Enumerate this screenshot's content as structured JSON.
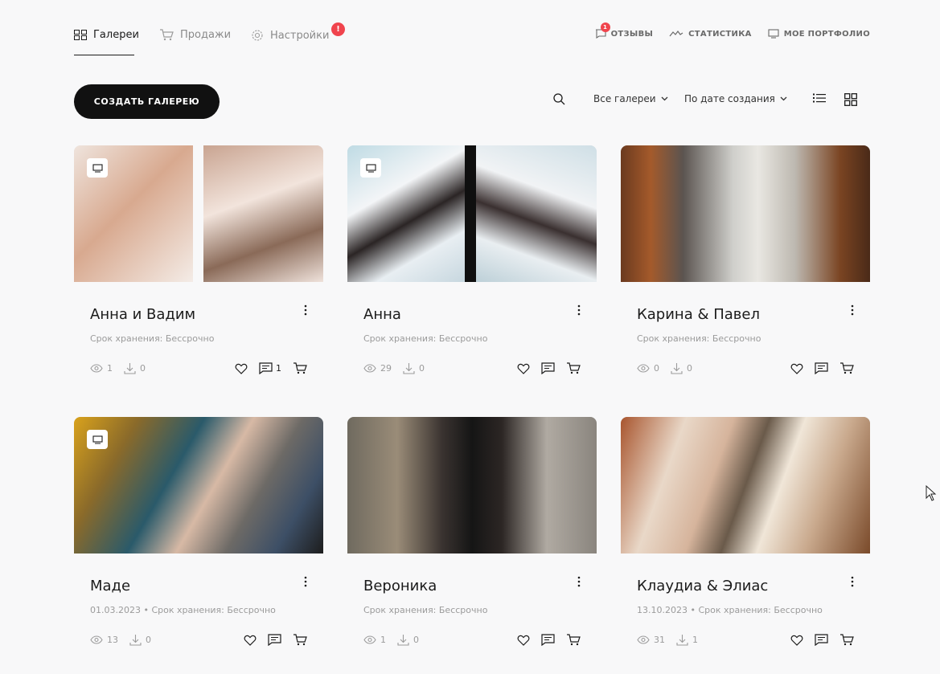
{
  "nav": {
    "tabs": [
      {
        "label": "Галереи"
      },
      {
        "label": "Продажи"
      },
      {
        "label": "Настройки"
      }
    ],
    "alert_badge": "!",
    "right_links": [
      {
        "label": "ОТЗЫВЫ",
        "badge": "1"
      },
      {
        "label": "СТАТИСТИКА"
      },
      {
        "label": "МОЕ ПОРТФОЛИО"
      }
    ]
  },
  "toolbar": {
    "create_label": "СОЗДАТЬ ГАЛЕРЕЮ",
    "filter_label": "Все галереи",
    "sort_label": "По дате создания"
  },
  "colors": {
    "accent": "#111111",
    "badge": "#f0444d",
    "muted": "#9b9b9b"
  },
  "galleries": [
    {
      "title": "Анна и Вадим",
      "meta": "Срок хранения: Бессрочно",
      "views": "1",
      "downloads": "0",
      "comments": "1"
    },
    {
      "title": "Анна",
      "meta": "Срок хранения: Бессрочно",
      "views": "29",
      "downloads": "0",
      "comments": ""
    },
    {
      "title": "Карина & Павел",
      "meta": "Срок хранения: Бессрочно",
      "views": "0",
      "downloads": "0",
      "comments": ""
    },
    {
      "title": "Маде",
      "meta": "01.03.2023 • Срок хранения: Бессрочно",
      "views": "13",
      "downloads": "0",
      "comments": ""
    },
    {
      "title": "Вероника",
      "meta": "Срок хранения: Бессрочно",
      "views": "1",
      "downloads": "0",
      "comments": ""
    },
    {
      "title": "Клаудиа & Элиас",
      "meta": "13.10.2023 • Срок хранения: Бессрочно",
      "views": "31",
      "downloads": "1",
      "comments": ""
    }
  ]
}
